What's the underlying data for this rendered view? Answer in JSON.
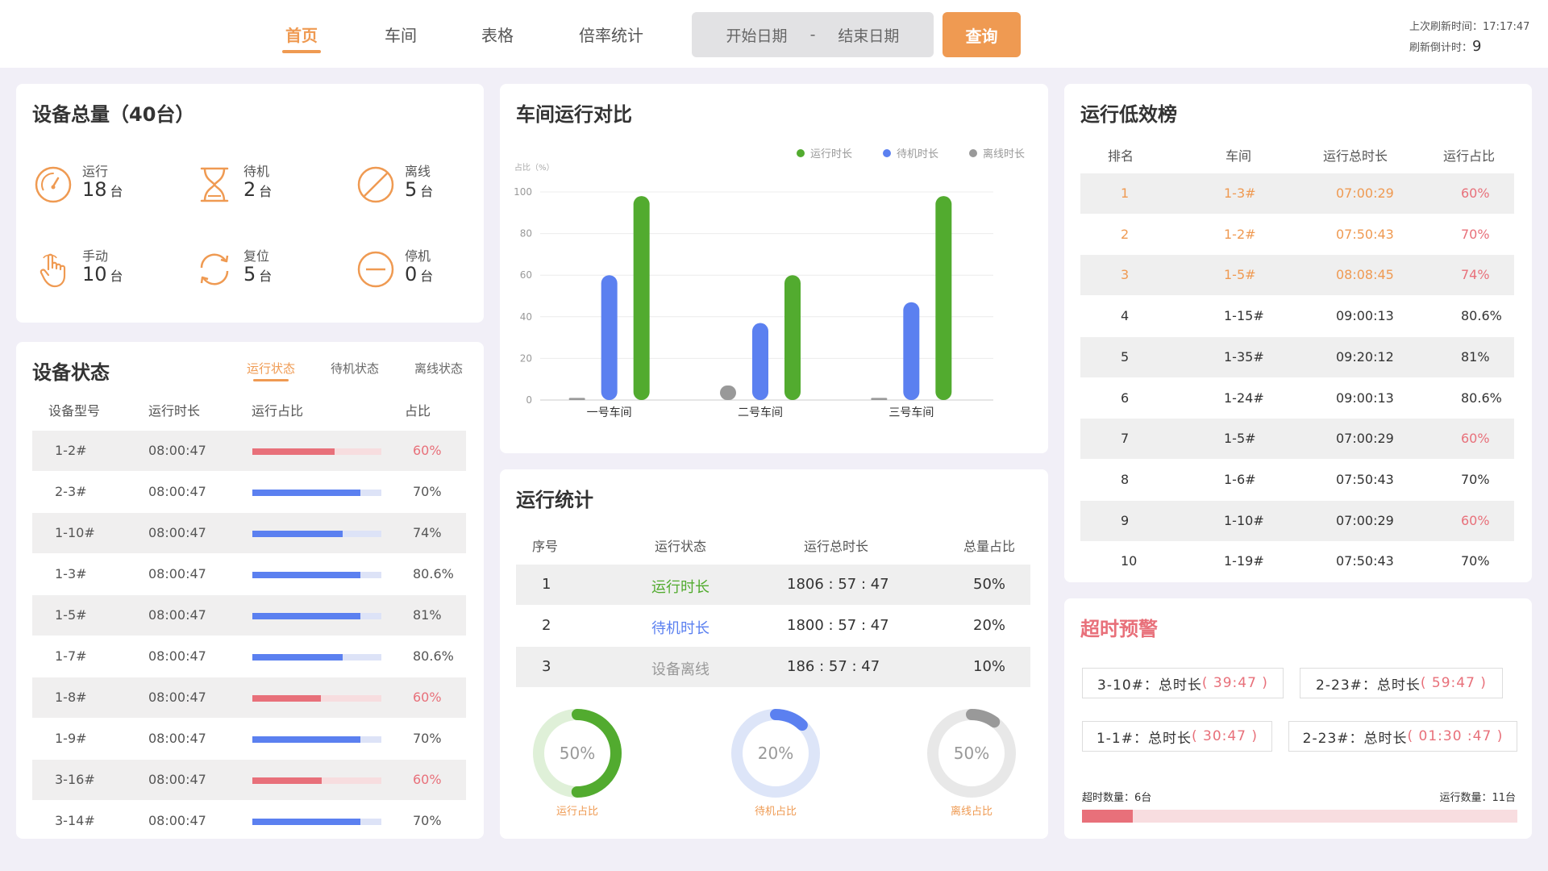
{
  "header": {
    "nav": [
      {
        "label": "首页",
        "active": true
      },
      {
        "label": "车间",
        "active": false
      },
      {
        "label": "表格",
        "active": false
      },
      {
        "label": "倍率统计",
        "active": false
      }
    ],
    "date_start": "开始日期",
    "date_sep": "-",
    "date_end": "结束日期",
    "query_label": "查询",
    "last_refresh_label": "上次刷新时间：",
    "last_refresh_value": "17:17:47",
    "countdown_label": "刷新倒计时：",
    "countdown_value": "9",
    "accent": "#ef9a52"
  },
  "total": {
    "title": "设备总量（40台）",
    "unit": "台",
    "stats": [
      {
        "label": "运行",
        "value": "18",
        "icon": "gauge-icon"
      },
      {
        "label": "待机",
        "value": "2",
        "icon": "hourglass-icon"
      },
      {
        "label": "离线",
        "value": "5",
        "icon": "ban-icon"
      },
      {
        "label": "手动",
        "value": "10",
        "icon": "hand-icon"
      },
      {
        "label": "复位",
        "value": "5",
        "icon": "reset-icon"
      },
      {
        "label": "停机",
        "value": "0",
        "icon": "stop-icon"
      }
    ]
  },
  "device_status": {
    "title": "设备状态",
    "tabs": [
      {
        "label": "运行状态",
        "active": true
      },
      {
        "label": "待机状态",
        "active": false
      },
      {
        "label": "离线状态",
        "active": false
      }
    ],
    "headers": [
      "设备型号",
      "运行时长",
      "运行占比",
      "占比"
    ],
    "rows": [
      {
        "model": "1-2#",
        "duration": "08:00:47",
        "pct": "60%",
        "value": 0.64,
        "alert": true
      },
      {
        "model": "2-3#",
        "duration": "08:00:47",
        "pct": "70%",
        "value": 0.84,
        "alert": false
      },
      {
        "model": "1-10#",
        "duration": "08:00:47",
        "pct": "74%",
        "value": 0.7,
        "alert": false
      },
      {
        "model": "1-3#",
        "duration": "08:00:47",
        "pct": "80.6%",
        "value": 0.84,
        "alert": false
      },
      {
        "model": "1-5#",
        "duration": "08:00:47",
        "pct": "81%",
        "value": 0.84,
        "alert": false
      },
      {
        "model": "1-7#",
        "duration": "08:00:47",
        "pct": "80.6%",
        "value": 0.7,
        "alert": false
      },
      {
        "model": "1-8#",
        "duration": "08:00:47",
        "pct": "60%",
        "value": 0.53,
        "alert": true
      },
      {
        "model": "1-9#",
        "duration": "08:00:47",
        "pct": "70%",
        "value": 0.84,
        "alert": false
      },
      {
        "model": "3-16#",
        "duration": "08:00:47",
        "pct": "60%",
        "value": 0.54,
        "alert": true
      },
      {
        "model": "3-14#",
        "duration": "08:00:47",
        "pct": "70%",
        "value": 0.84,
        "alert": false
      }
    ],
    "colors": {
      "normal": "#5b80f0",
      "normal_track": "#dde3f7",
      "alert": "#e8707a",
      "alert_track": "#f7dddf"
    }
  },
  "workshop": {
    "title": "车间运行对比",
    "chart_data": {
      "type": "bar",
      "ylabel": "占比（%）",
      "ylim": [
        0,
        100
      ],
      "yticks": [
        0,
        20,
        40,
        60,
        80,
        100
      ],
      "categories": [
        "一号车间",
        "二号车间",
        "三号车间"
      ],
      "series": [
        {
          "name": "离线时长",
          "color": "#999999",
          "values": [
            1,
            7,
            1
          ]
        },
        {
          "name": "待机时长",
          "color": "#5b80f0",
          "values": [
            60,
            37,
            47
          ]
        },
        {
          "name": "运行时长",
          "color": "#52ab2f",
          "values": [
            98,
            60,
            98
          ]
        }
      ],
      "legend_order": [
        "运行时长",
        "待机时长",
        "离线时长"
      ],
      "legend": "top-right",
      "grid": true
    }
  },
  "run_stats": {
    "title": "运行统计",
    "headers": [
      "序号",
      "运行状态",
      "运行总时长",
      "总量占比"
    ],
    "rows": [
      {
        "no": "1",
        "status": "运行时长",
        "total": "1806 : 57 : 47",
        "pct": "50%",
        "color": "#52ab2f"
      },
      {
        "no": "2",
        "status": "待机时长",
        "total": "1800 : 57 : 47",
        "pct": "20%",
        "color": "#5b80f0"
      },
      {
        "no": "3",
        "status": "设备离线",
        "total": "186 : 57 : 47",
        "pct": "10%",
        "color": "#999999"
      }
    ],
    "donuts": [
      {
        "label": "运行占比",
        "text": "50%",
        "value": 0.5,
        "color": "#52ab2f",
        "track": "#dff0d8"
      },
      {
        "label": "待机占比",
        "text": "20%",
        "value": 0.12,
        "color": "#5b80f0",
        "track": "#dde5f8"
      },
      {
        "label": "离线占比",
        "text": "50%",
        "value": 0.1,
        "color": "#999999",
        "track": "#e8e8e8"
      }
    ]
  },
  "low_eff": {
    "title": "运行低效榜",
    "headers": [
      "排名",
      "车间",
      "运行总时长",
      "运行占比"
    ],
    "rows": [
      {
        "rank": "1",
        "ws": "1-3#",
        "total": "07:00:29",
        "pct": "60%",
        "hl": "all"
      },
      {
        "rank": "2",
        "ws": "1-2#",
        "total": "07:50:43",
        "pct": "70%",
        "hl": "all"
      },
      {
        "rank": "3",
        "ws": "1-5#",
        "total": "08:08:45",
        "pct": "74%",
        "hl": "all"
      },
      {
        "rank": "4",
        "ws": "1-15#",
        "total": "09:00:13",
        "pct": "80.6%",
        "hl": "none"
      },
      {
        "rank": "5",
        "ws": "1-35#",
        "total": "09:20:12",
        "pct": "81%",
        "hl": "none"
      },
      {
        "rank": "6",
        "ws": "1-24#",
        "total": "09:00:13",
        "pct": "80.6%",
        "hl": "none"
      },
      {
        "rank": "7",
        "ws": "1-5#",
        "total": "07:00:29",
        "pct": "60%",
        "hl": "pct"
      },
      {
        "rank": "8",
        "ws": "1-6#",
        "total": "07:50:43",
        "pct": "70%",
        "hl": "none"
      },
      {
        "rank": "9",
        "ws": "1-10#",
        "total": "07:00:29",
        "pct": "60%",
        "hl": "pct"
      },
      {
        "rank": "10",
        "ws": "1-19#",
        "total": "07:50:43",
        "pct": "70%",
        "hl": "none"
      }
    ],
    "colors": {
      "orange": "#ef9a52",
      "red": "#e8707a"
    }
  },
  "overtime": {
    "title": "超时预警",
    "items": [
      {
        "name": "3-10#：总时长",
        "time": "( 39:47 )"
      },
      {
        "name": "2-23#：总时长",
        "time": "( 59:47 )"
      },
      {
        "name": "1-1#：总时长",
        "time": "( 30:47 )"
      },
      {
        "name": "2-23#：总时长",
        "time": "( 01:30 :47 )"
      }
    ],
    "count_label": "超时数量：6台",
    "run_count_label": "运行数量：11台",
    "overtime": 6,
    "running": 11,
    "color": "#e8707a",
    "track": "#f8dde0"
  }
}
